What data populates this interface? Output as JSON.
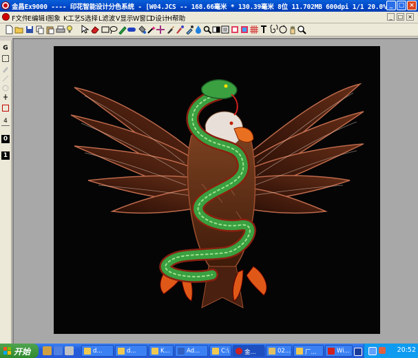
{
  "window": {
    "title": "金昌Ex9000 ---- 印花智能设计分色系统 - [W04.JCS -- 168.66毫米 * 130.39毫米 8位  11.702MB 600dpi 1/1  20.0%]",
    "minimize_glyph": "_",
    "maximize_glyph": "□",
    "close_glyph": "×"
  },
  "menu": {
    "items": [
      "F文件",
      "E编辑",
      "I图象",
      "K工艺",
      "S选择",
      "L滤波",
      "V显示",
      "W窗口",
      "D设计",
      "H帮助"
    ],
    "mdi_buttons": [
      "_",
      "□",
      "×"
    ]
  },
  "toolbar": {
    "icons": [
      "new-icon",
      "open-icon",
      "save-icon",
      "copy-icon",
      "print-icon",
      "tip-icon",
      "pointer-icon",
      "eraser-icon",
      "rectangle-icon",
      "lasso-icon",
      "pen-icon",
      "gamepad-icon",
      "fill-bucket-icon",
      "magic-wand-icon",
      "crosshair-icon",
      "brush-icon",
      "clone-icon",
      "dropper-icon",
      "mask-icon",
      "zoom-icon",
      "stamp-icon",
      "layer-icon",
      "grid-icon",
      "text-icon",
      "spiral-icon",
      "hand-icon",
      "magnifier-icon"
    ]
  },
  "left_panel": {
    "top_label": "G",
    "number_top": "4",
    "number_black_1": "0",
    "number_black_2": "1"
  },
  "taskbar": {
    "start_label": "开始",
    "buttons": [
      {
        "label": "d..."
      },
      {
        "label": "d..."
      },
      {
        "label": "K..."
      },
      {
        "label": "Ad..."
      },
      {
        "label": "C:\\"
      },
      {
        "label": "金..."
      },
      {
        "label": "02..."
      },
      {
        "label": "厂..."
      },
      {
        "label": "Wi..."
      }
    ],
    "clock": "20:52"
  },
  "colors": {
    "title_blue": "#0046c8",
    "taskbar_blue": "#245edb",
    "start_green": "#3a963a",
    "canvas_gray": "#a8a8a8",
    "artwork_black": "#050505"
  }
}
